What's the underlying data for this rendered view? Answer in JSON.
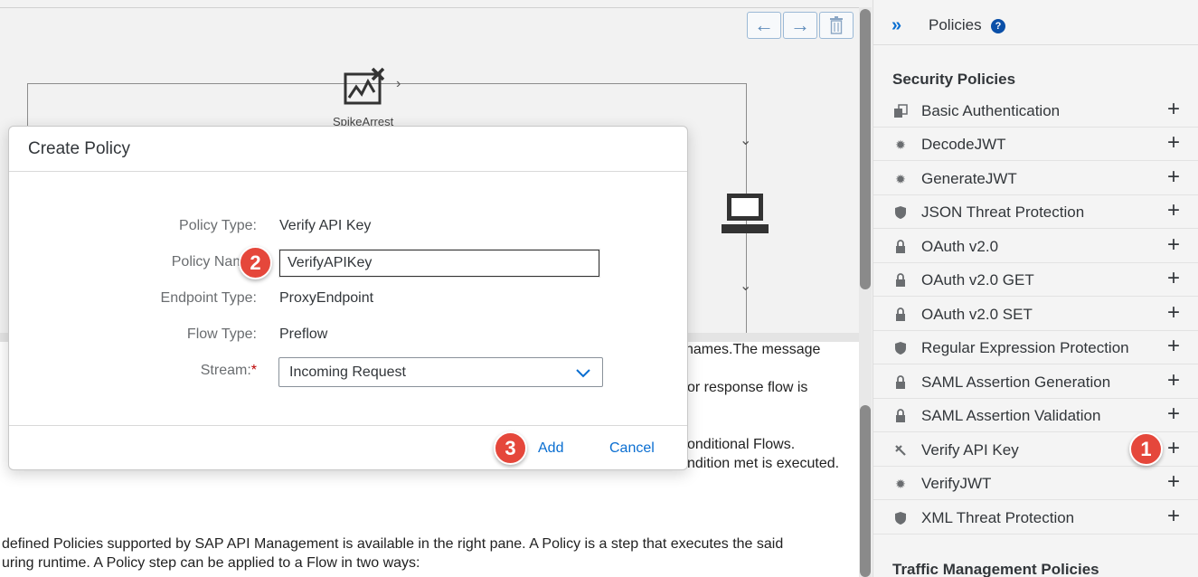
{
  "canvas": {
    "nav_back_icon": "arrow-left-icon",
    "nav_forward_icon": "arrow-right-icon",
    "delete_icon": "trash-icon",
    "spike_label": "SpikeArrest"
  },
  "doc": {
    "lines": [
      "names.The message",
      "or response flow is",
      "onditional Flows.",
      "ndition met is executed.",
      "defined Policies supported by SAP API Management is available in the right pane. A Policy is a step that executes the said",
      "uring runtime. A Policy step can be applied to a Flow in two ways:"
    ]
  },
  "modal": {
    "title": "Create Policy",
    "rows": {
      "policy_type_label": "Policy Type:",
      "policy_type_value": "Verify API Key",
      "policy_name_label": "Policy Name:",
      "policy_name_value": "VerifyAPIKey",
      "endpoint_type_label": "Endpoint Type:",
      "endpoint_type_value": "ProxyEndpoint",
      "flow_type_label": "Flow Type:",
      "flow_type_value": "Preflow",
      "stream_label": "Stream:",
      "stream_required": "*",
      "stream_value": "Incoming Request"
    },
    "add_label": "Add",
    "cancel_label": "Cancel"
  },
  "badges": {
    "one": "1",
    "two": "2",
    "three": "3"
  },
  "panel": {
    "title": "Policies",
    "help": "?",
    "security_title": "Security Policies",
    "traffic_title": "Traffic Management Policies",
    "items": [
      {
        "label": "Basic Authentication",
        "icon": "id-card-icon"
      },
      {
        "label": "DecodeJWT",
        "icon": "gear-icon"
      },
      {
        "label": "GenerateJWT",
        "icon": "gear-icon"
      },
      {
        "label": "JSON Threat Protection",
        "icon": "shield-icon"
      },
      {
        "label": "OAuth v2.0",
        "icon": "lock-icon"
      },
      {
        "label": "OAuth v2.0 GET",
        "icon": "lock-icon"
      },
      {
        "label": "OAuth v2.0 SET",
        "icon": "lock-icon"
      },
      {
        "label": "Regular Expression Protection",
        "icon": "shield-icon"
      },
      {
        "label": "SAML Assertion Generation",
        "icon": "lock-icon"
      },
      {
        "label": "SAML Assertion Validation",
        "icon": "lock-icon"
      },
      {
        "label": "Verify API Key",
        "icon": "key-icon"
      },
      {
        "label": "VerifyJWT",
        "icon": "gear-icon"
      },
      {
        "label": "XML Threat Protection",
        "icon": "shield-icon"
      }
    ],
    "add_symbol": "+"
  },
  "colors": {
    "accent": "#0a6ed1",
    "badge": "#e5473b",
    "required": "#bb0000"
  }
}
